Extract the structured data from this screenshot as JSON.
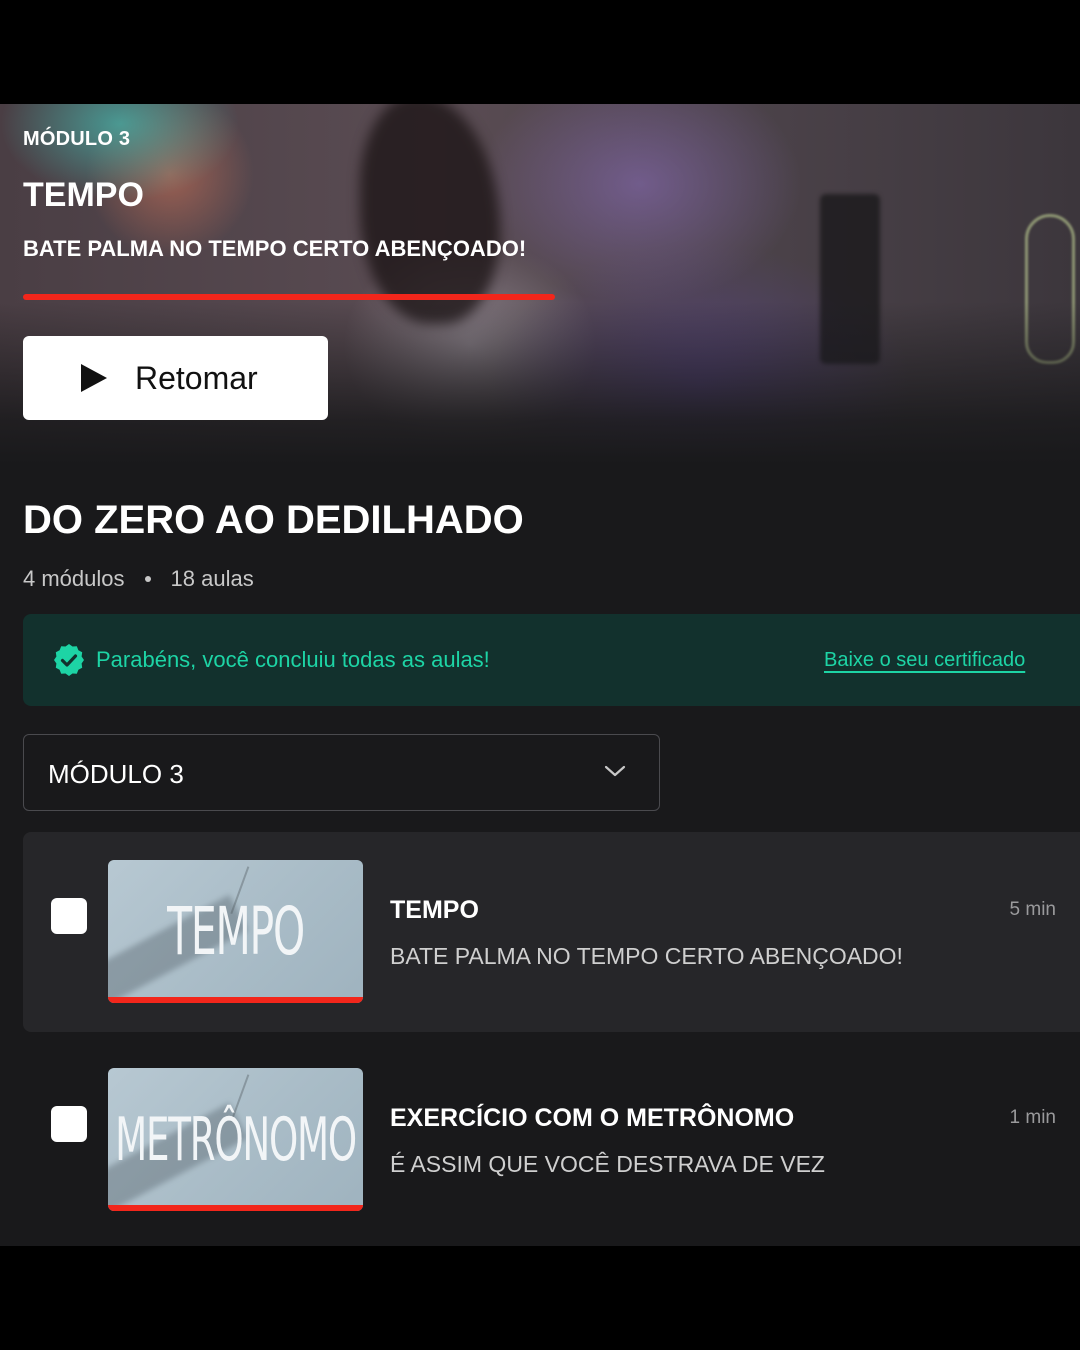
{
  "hero": {
    "module_label": "MÓDULO 3",
    "title": "TEMPO",
    "subtitle": "BATE PALMA NO TEMPO CERTO ABENÇOADO!",
    "progress": 1.0,
    "resume_label": "Retomar"
  },
  "course": {
    "title": "DO ZERO AO DEDILHADO",
    "modules": "4 módulos",
    "lessons": "18 aulas"
  },
  "banner": {
    "message": "Parabéns, você concluiu todas as aulas!",
    "link": "Baixe o seu certificado",
    "color": "#1dd4a5"
  },
  "module_select": {
    "selected": "MÓDULO 3"
  },
  "lessons": [
    {
      "thumb_text": "TEMPO",
      "title": "TEMPO",
      "subtitle": "BATE PALMA NO TEMPO CERTO ABENÇOADO!",
      "duration": "5 min",
      "progress": 1.0
    },
    {
      "thumb_text": "METRÔNOMO",
      "title": "EXERCÍCIO COM O METRÔNOMO",
      "subtitle": "É ASSIM QUE VOCÊ DESTRAVA DE VEZ",
      "duration": "1 min",
      "progress": 1.0
    }
  ],
  "colors": {
    "accent_red": "#f2261b",
    "success_green": "#1dd4a5"
  },
  "icons": {
    "play": "play-icon",
    "check": "check-circle-icon",
    "chevron": "chevron-down-icon"
  }
}
